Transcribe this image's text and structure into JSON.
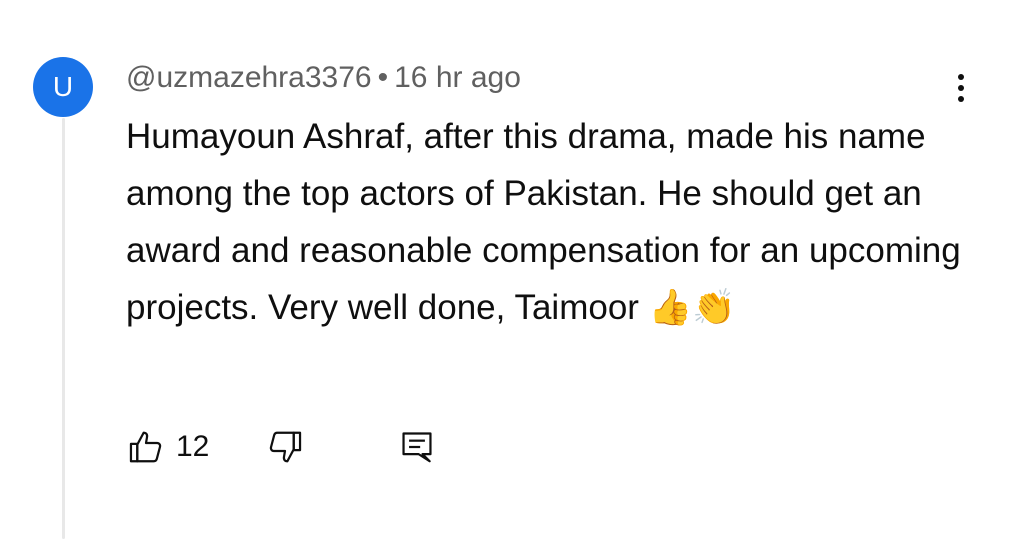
{
  "comment": {
    "avatar_letter": "U",
    "author": "@uzmazehra3376",
    "separator": "•",
    "time": "16 hr ago",
    "text": "Humayoun Ashraf, after this drama, made his name among the top actors of Pakistan. He should get an award and reasonable compensation for an upcoming projects. Very well done, Taimoor 👍👏",
    "like_count": "12"
  },
  "icons": {
    "menu": "more-vert-icon",
    "like": "thumb-up-icon",
    "dislike": "thumb-down-icon",
    "reply": "reply-comment-icon"
  },
  "colors": {
    "avatar_bg": "#1a73e8",
    "meta_text": "#606060",
    "main_text": "#0f0f0f",
    "thread_line": "#e8e8e8"
  }
}
